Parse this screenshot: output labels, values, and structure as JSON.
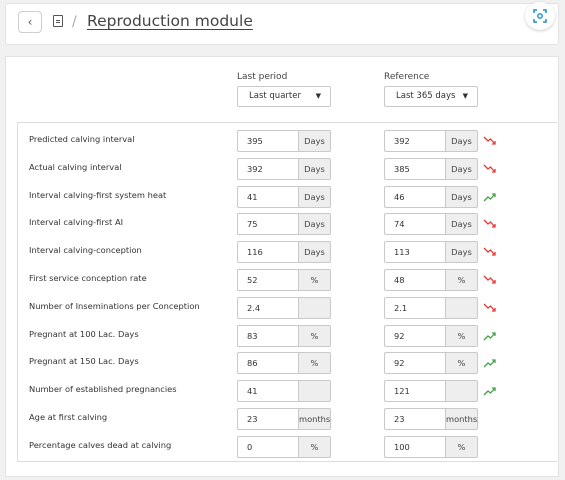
{
  "header": {
    "title": "Reproduction module",
    "separator": "/"
  },
  "columns": {
    "last_period": {
      "label": "Last period",
      "selected": "Last quarter"
    },
    "reference": {
      "label": "Reference",
      "selected": "Last 365 days"
    }
  },
  "colors": {
    "trend_down": "#e53935",
    "trend_up": "#43a047"
  },
  "rows": [
    {
      "label": "Predicted calving interval",
      "last_value": "395",
      "last_unit": "Days",
      "ref_value": "392",
      "ref_unit": "Days",
      "trend": "down"
    },
    {
      "label": "Actual calving interval",
      "last_value": "392",
      "last_unit": "Days",
      "ref_value": "385",
      "ref_unit": "Days",
      "trend": "down"
    },
    {
      "label": "Interval calving-first system heat",
      "last_value": "41",
      "last_unit": "Days",
      "ref_value": "46",
      "ref_unit": "Days",
      "trend": "up"
    },
    {
      "label": "Interval calving-first AI",
      "last_value": "75",
      "last_unit": "Days",
      "ref_value": "74",
      "ref_unit": "Days",
      "trend": "down"
    },
    {
      "label": "Interval calving-conception",
      "last_value": "116",
      "last_unit": "Days",
      "ref_value": "113",
      "ref_unit": "Days",
      "trend": "down"
    },
    {
      "label": "First service conception rate",
      "last_value": "52",
      "last_unit": "%",
      "ref_value": "48",
      "ref_unit": "%",
      "trend": "down"
    },
    {
      "label": "Number of Inseminations per Conception",
      "last_value": "2.4",
      "last_unit": "",
      "ref_value": "2.1",
      "ref_unit": "",
      "trend": "down"
    },
    {
      "label": "Pregnant at 100 Lac. Days",
      "last_value": "83",
      "last_unit": "%",
      "ref_value": "92",
      "ref_unit": "%",
      "trend": "up"
    },
    {
      "label": "Pregnant at 150 Lac. Days",
      "last_value": "86",
      "last_unit": "%",
      "ref_value": "92",
      "ref_unit": "%",
      "trend": "up"
    },
    {
      "label": "Number of established pregnancies",
      "last_value": "41",
      "last_unit": "",
      "ref_value": "121",
      "ref_unit": "",
      "trend": "up"
    },
    {
      "label": "Age at first calving",
      "last_value": "23",
      "last_unit": "months",
      "ref_value": "23",
      "ref_unit": "months",
      "trend": "none"
    },
    {
      "label": "Percentage calves dead at calving",
      "last_value": "0",
      "last_unit": "%",
      "ref_value": "100",
      "ref_unit": "%",
      "trend": "none"
    }
  ]
}
